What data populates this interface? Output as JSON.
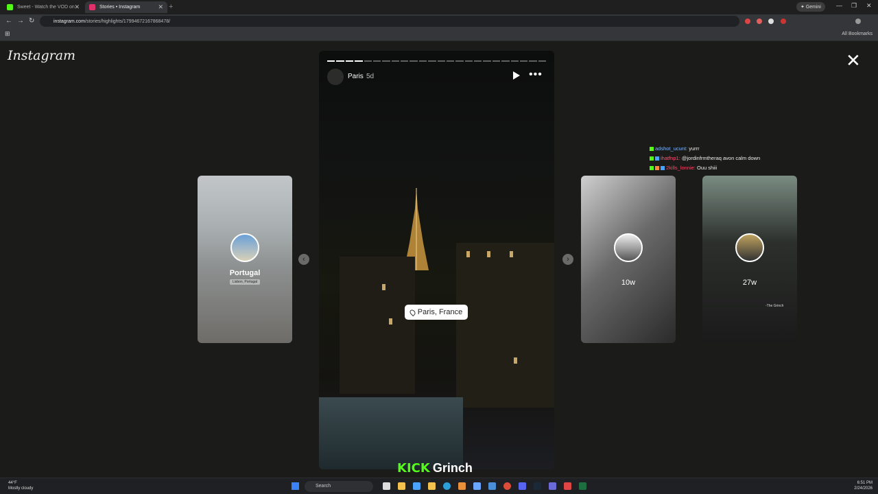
{
  "browser": {
    "tabs": [
      {
        "title": "Sweet - Watch the VOD on",
        "active": false
      },
      {
        "title": "Stories • Instagram",
        "active": true
      }
    ],
    "gemini_label": "Gemini",
    "url_domain": "instagram.com",
    "url_path": "/stories/highlights/17994672167868478/",
    "all_bookmarks": "All Bookmarks"
  },
  "instagram": {
    "logo": "Instagram",
    "close": "✕",
    "story": {
      "username": "Paris",
      "age": "5d",
      "location_sticker": "Paris, France",
      "progress_total": 24,
      "progress_done": 4
    },
    "side_cards": [
      {
        "label": "Portugal",
        "sub": "Lisbon, Portugal"
      },
      {
        "label": "10w"
      },
      {
        "label": "27w",
        "caption": "-The Grinch"
      }
    ]
  },
  "chat": [
    {
      "user": "adshot_ucunt:",
      "message": "yurrr",
      "user_color": "#7fb6ff"
    },
    {
      "user": "ihatfnp1:",
      "message": "@jordinfrmtheraq avon calm down",
      "user_color": "#ff5577"
    },
    {
      "user": "2kills_lonnie:",
      "message": "Ouu shiii",
      "user_color": "#ff4466"
    }
  ],
  "overlay": {
    "kick": "KICK",
    "name": "Grinch"
  },
  "taskbar": {
    "weather_temp": "44°F",
    "weather_desc": "Mostly cloudy",
    "search_placeholder": "Search",
    "time": "6:51 PM",
    "date": "2/24/2026"
  }
}
